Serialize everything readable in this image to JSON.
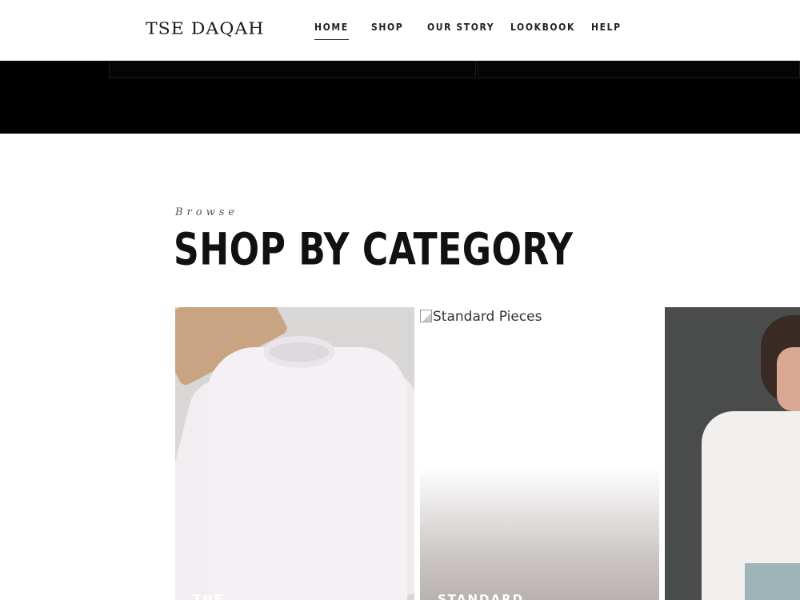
{
  "header": {
    "logo": "TSE DAQAH",
    "nav": [
      {
        "label": "HOME",
        "active": true
      },
      {
        "label": "SHOP",
        "active": false
      },
      {
        "label": "OUR STORY",
        "active": false
      },
      {
        "label": "LOOKBOOK",
        "active": false
      },
      {
        "label": "HELP",
        "active": false
      }
    ]
  },
  "category_section": {
    "eyebrow": "Browse",
    "title": "SHOP BY CATEGORY",
    "cards": [
      {
        "label": "THE"
      },
      {
        "label": "STANDARD",
        "image_alt": "Standard Pieces"
      },
      {
        "label": ""
      }
    ]
  }
}
